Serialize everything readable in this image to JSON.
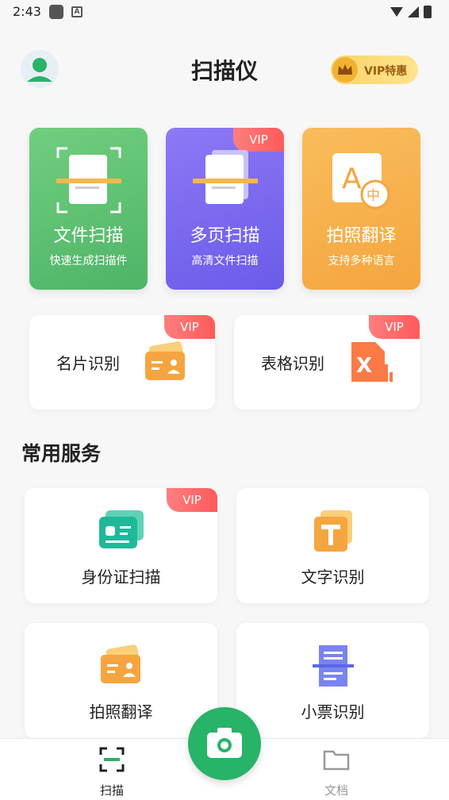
{
  "status_bar": {
    "time": "2:43"
  },
  "header": {
    "title": "扫描仪",
    "vip_badge": "VIP特惠"
  },
  "tiles": [
    {
      "name": "文件扫描",
      "sub": "快速生成扫描件",
      "vip": ""
    },
    {
      "name": "多页扫描",
      "sub": "高清文件扫描",
      "vip": "VIP"
    },
    {
      "name": "拍照翻译",
      "sub": "支持多种语言",
      "vip": ""
    }
  ],
  "mid_cards": [
    {
      "name": "名片识别",
      "vip": "VIP"
    },
    {
      "name": "表格识别",
      "vip": "VIP"
    }
  ],
  "section_title": "常用服务",
  "services": [
    {
      "name": "身份证扫描",
      "vip": "VIP"
    },
    {
      "name": "文字识别",
      "vip": ""
    },
    {
      "name": "拍照翻译",
      "vip": ""
    },
    {
      "name": "小票识别",
      "vip": ""
    }
  ],
  "nav": {
    "scan": "扫描",
    "docs": "文档"
  },
  "colors": {
    "accent": "#27b368",
    "vip": "#ff5a5a"
  }
}
